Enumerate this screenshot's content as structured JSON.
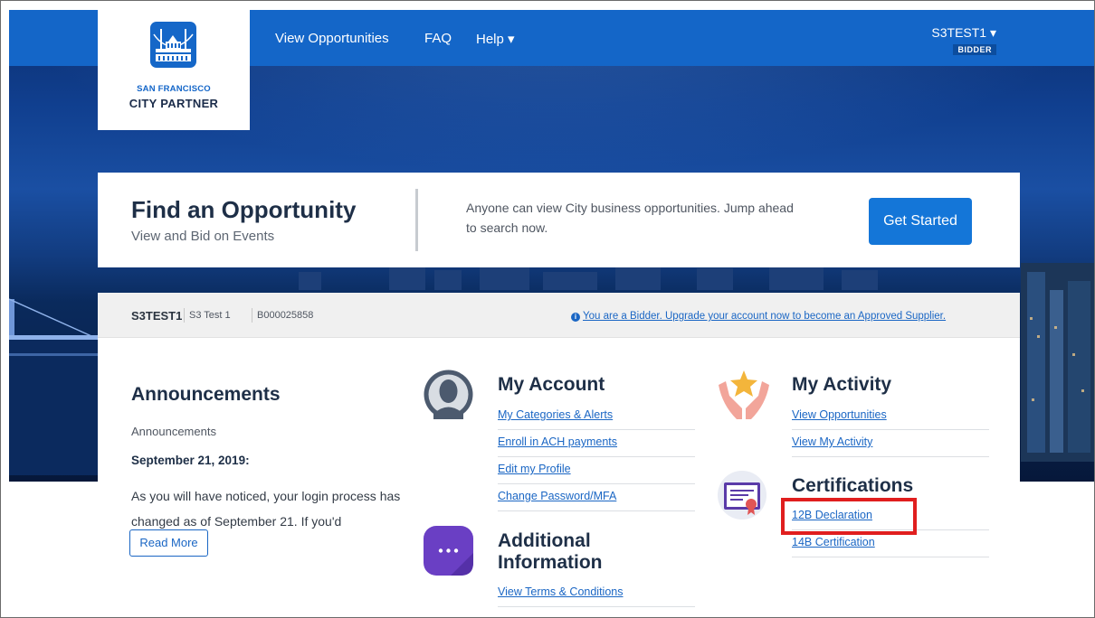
{
  "nav": {
    "logo_line1": "SAN FRANCISCO",
    "logo_line2": "CITY PARTNER",
    "links": [
      "View Opportunities",
      "FAQ",
      "Help ▾"
    ],
    "user_name": "S3TEST1 ▾",
    "user_role": "BIDDER"
  },
  "find": {
    "title": "Find an Opportunity",
    "subtitle": "View and Bid on Events",
    "description": "Anyone can view City business opportunities. Jump ahead to search now.",
    "button": "Get Started"
  },
  "account_bar": {
    "id": "S3TEST1",
    "name": "S3 Test 1",
    "number": "B000025858",
    "upgrade": "You are a Bidder. Upgrade your account now to become an Approved Supplier."
  },
  "announcements": {
    "title": "Announcements",
    "label": "Announcements",
    "date": "September 21, 2019:",
    "body": "As you will have noticed, your login process has changed as of September 21. If you'd",
    "read_more": "Read More"
  },
  "my_account": {
    "title": "My Account",
    "links": [
      "My Categories & Alerts",
      "Enroll in ACH payments",
      "Edit my Profile",
      "Change Password/MFA"
    ]
  },
  "additional_info": {
    "title": "Additional Information",
    "links": [
      "View Terms & Conditions"
    ]
  },
  "my_activity": {
    "title": "My Activity",
    "links": [
      "View Opportunities",
      "View My Activity"
    ]
  },
  "certifications": {
    "title": "Certifications",
    "links": [
      "12B Declaration",
      "14B Certification"
    ]
  },
  "colors": {
    "primary": "#1466c8",
    "link": "#1a66c4",
    "highlight": "#e01e1e"
  }
}
